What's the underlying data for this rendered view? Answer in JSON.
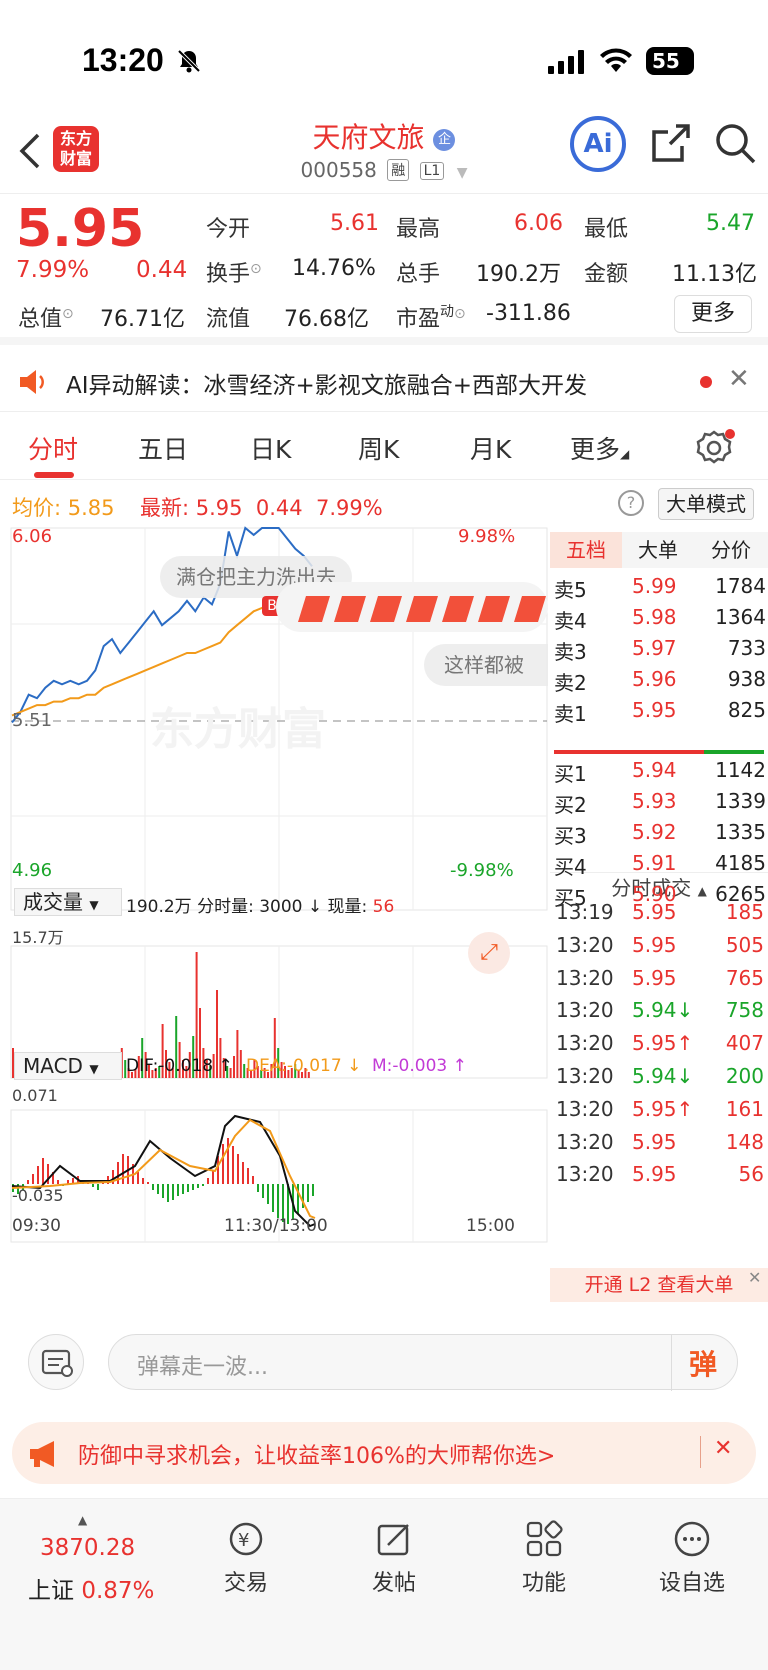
{
  "status_bar": {
    "time": "13:20",
    "battery": "55"
  },
  "header": {
    "logo_text": "东方财富",
    "stock_name": "天府文旅",
    "stock_code": "000558",
    "tags": [
      "融",
      "L1"
    ],
    "ai_label": "Ai"
  },
  "quote": {
    "price": "5.95",
    "change_pct": "7.99%",
    "change": "0.44",
    "open_label": "今开",
    "open": "5.61",
    "high_label": "最高",
    "high": "6.06",
    "low_label": "最低",
    "low": "5.47",
    "turnover_label": "换手",
    "turnover": "14.76%",
    "volume_label": "总手",
    "volume": "190.2万",
    "amount_label": "金额",
    "amount": "11.13亿",
    "mktcap_label": "总值",
    "mktcap": "76.71亿",
    "float_label": "流值",
    "float": "76.68亿",
    "pe_label": "市盈",
    "pe_sup": "动",
    "pe": "-311.86",
    "more_label": "更多"
  },
  "ai_banner": {
    "text": "AI异动解读：冰雪经济+影视文旅融合+西部大开发"
  },
  "tabs": [
    {
      "label": "分时",
      "active": true
    },
    {
      "label": "五日"
    },
    {
      "label": "日K"
    },
    {
      "label": "周K"
    },
    {
      "label": "月K"
    },
    {
      "label": "更多"
    }
  ],
  "info_line": {
    "avg_label": "均价:",
    "avg": "5.85",
    "latest_label": "最新:",
    "latest": "5.95",
    "change": "0.44",
    "pct": "7.99%",
    "big_order_mode": "大单模式"
  },
  "chart_labels": {
    "ymax": "6.06",
    "ymin": "4.96",
    "pmax": "9.98%",
    "pmin": "-9.98%",
    "base": "5.51",
    "watermark": "东方财富",
    "bubble1": "满仓把主力洗出去",
    "bubble2": "这样都被",
    "buy_marker": "B",
    "vol_label": "成交量",
    "vol_total": "190.2万",
    "vol_info": "分时量: 3000 ↓ 现量:",
    "vol_now": "56",
    "vol_max": "15.7万",
    "macd_label": "MACD",
    "dif": "DIF:-0.018 ↑",
    "dea": "DEA:-0.017 ↓",
    "m": "M:-0.003 ↑",
    "macd_max": "0.071",
    "macd_min": "-0.035",
    "t_start": "09:30",
    "t_mid": "11:30/13:00",
    "t_end": "15:00"
  },
  "chart_data": {
    "type": "line",
    "series": [
      {
        "values": [
          5.5,
          5.53,
          5.58,
          5.57,
          5.6,
          5.62,
          5.61,
          5.62,
          5.61,
          5.62,
          5.65,
          5.72,
          5.74,
          5.7,
          5.73,
          5.76,
          5.79,
          5.82,
          5.78,
          5.8,
          5.82,
          5.85,
          5.82,
          5.86,
          5.84,
          5.9,
          6.05,
          5.98,
          6.06,
          6.04,
          6.06,
          6.06,
          6.06,
          6.03,
          6.0,
          5.98,
          5.95
        ]
      },
      {
        "values": [
          5.52,
          5.53,
          5.54,
          5.55,
          5.55,
          5.56,
          5.56,
          5.57,
          5.57,
          5.58,
          5.58,
          5.6,
          5.61,
          5.62,
          5.63,
          5.64,
          5.65,
          5.66,
          5.67,
          5.68,
          5.69,
          5.7,
          5.7,
          5.71,
          5.72,
          5.73,
          5.76,
          5.78,
          5.8,
          5.82,
          5.83,
          5.84,
          5.85,
          5.85,
          5.85,
          5.85,
          5.85
        ]
      }
    ],
    "ylim": [
      4.96,
      6.06
    ]
  },
  "order_book": {
    "tabs": [
      "五档",
      "大单",
      "分价"
    ],
    "sell": [
      {
        "label": "卖5",
        "price": "5.99",
        "vol": "1784"
      },
      {
        "label": "卖4",
        "price": "5.98",
        "vol": "1364"
      },
      {
        "label": "卖3",
        "price": "5.97",
        "vol": "733"
      },
      {
        "label": "卖2",
        "price": "5.96",
        "vol": "938"
      },
      {
        "label": "卖1",
        "price": "5.95",
        "vol": "825"
      }
    ],
    "buy": [
      {
        "label": "买1",
        "price": "5.94",
        "vol": "1142"
      },
      {
        "label": "买2",
        "price": "5.93",
        "vol": "1339"
      },
      {
        "label": "买3",
        "price": "5.92",
        "vol": "1335"
      },
      {
        "label": "买4",
        "price": "5.91",
        "vol": "4185"
      },
      {
        "label": "买5",
        "price": "5.90",
        "vol": "6265"
      }
    ],
    "ticks_title": "分时成交",
    "ticks": [
      {
        "time": "13:19",
        "price": "5.95",
        "vol": "185",
        "color": "#e8322f"
      },
      {
        "time": "13:20",
        "price": "5.95",
        "vol": "505",
        "color": "#e8322f"
      },
      {
        "time": "13:20",
        "price": "5.95",
        "vol": "765",
        "color": "#e8322f"
      },
      {
        "time": "13:20",
        "price": "5.94↓",
        "vol": "758",
        "color": "#1aa52a"
      },
      {
        "time": "13:20",
        "price": "5.95↑",
        "vol": "407",
        "color": "#e8322f"
      },
      {
        "time": "13:20",
        "price": "5.94↓",
        "vol": "200",
        "color": "#1aa52a"
      },
      {
        "time": "13:20",
        "price": "5.95↑",
        "vol": "161",
        "color": "#e8322f"
      },
      {
        "time": "13:20",
        "price": "5.95",
        "vol": "148",
        "color": "#e8322f"
      },
      {
        "time": "13:20",
        "price": "5.95",
        "vol": "56",
        "color": "#e8322f"
      }
    ],
    "l2_text": "开通 L2 查看大单"
  },
  "comment": {
    "placeholder": "弹幕走一波...",
    "danmu_label": "弹"
  },
  "promo": {
    "text": "防御中寻求机会，让收益率106%的大师帮你选>"
  },
  "bottom_nav": {
    "index_value": "3870.28",
    "index_name": "上证",
    "index_pct": "0.87%",
    "items": [
      "交易",
      "发帖",
      "功能",
      "设自选"
    ]
  }
}
